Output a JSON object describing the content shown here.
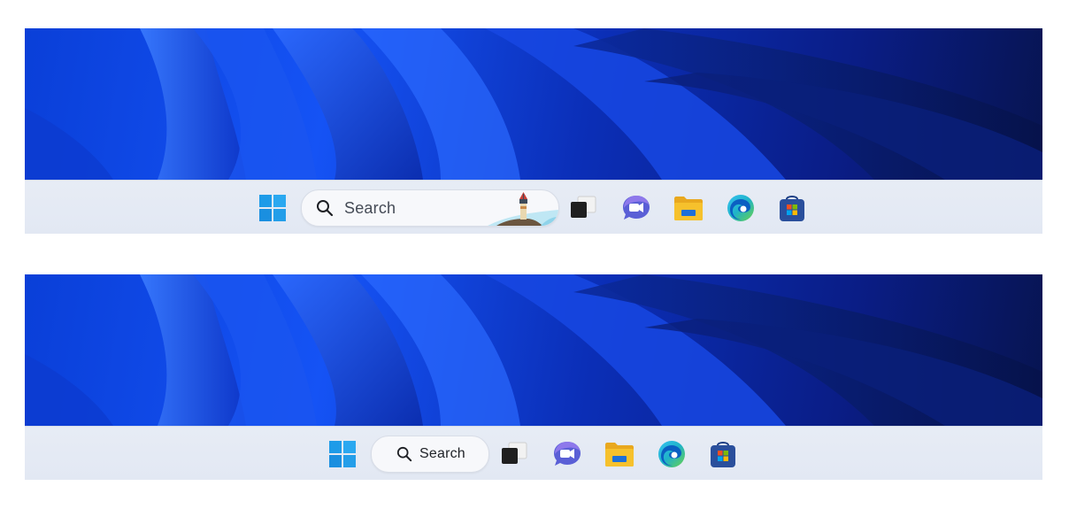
{
  "taskbar_full": {
    "search": {
      "placeholder": "Search"
    },
    "icons": [
      "windows-start-icon",
      "search-icon",
      "lighthouse-highlight-icon",
      "task-view-icon",
      "teams-chat-icon",
      "file-explorer-icon",
      "edge-browser-icon",
      "microsoft-store-icon"
    ]
  },
  "taskbar_compact": {
    "search": {
      "placeholder": "Search"
    },
    "icons": [
      "windows-start-icon",
      "search-icon",
      "task-view-icon",
      "teams-chat-icon",
      "file-explorer-icon",
      "edge-browser-icon",
      "microsoft-store-icon"
    ]
  },
  "colors": {
    "wallpaper_blue": "#1553f5",
    "taskbar_bg": "#e4e9f3",
    "start_blue": "#1e9be8",
    "chat_purple": "#5a5fd6",
    "folder_yellow": "#f6c12c",
    "edge_teal": "#1fb3c8",
    "store_navy": "#2a4f9c"
  }
}
